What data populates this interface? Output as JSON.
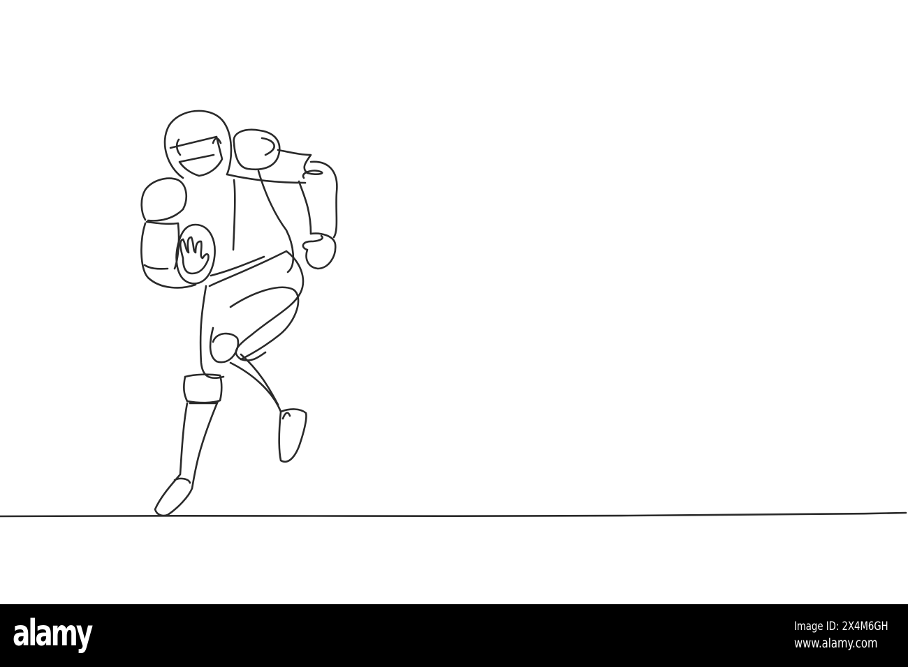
{
  "illustration": {
    "subject": "football-player-line-drawing",
    "stroke_color": "#2a2a2a",
    "background_color": "#ffffff"
  },
  "watermark": {
    "logo_text": "alamy",
    "image_id_label": "Image ID: 2X4M6GH",
    "url": "www.alamy.com",
    "background_color": "#000000"
  }
}
